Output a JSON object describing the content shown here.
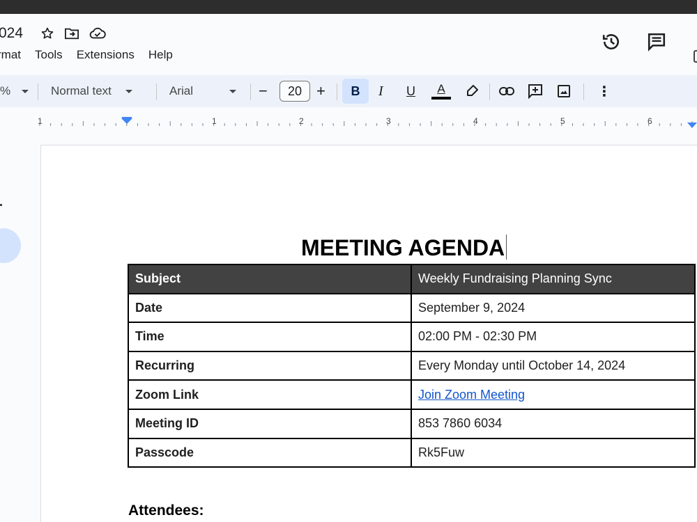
{
  "doc": {
    "title_fragment": "024",
    "menus": [
      "rmat",
      "Tools",
      "Extensions",
      "Help"
    ]
  },
  "toolbar": {
    "zoom_fragment": "%",
    "style": "Normal text",
    "font": "Arial",
    "font_size": "20",
    "bold": "B",
    "italic": "I",
    "underline": "U",
    "text_color": "A",
    "decrease": "−",
    "increase": "+",
    "more": "⋮"
  },
  "ruler": {
    "labels": [
      "1",
      "1",
      "2",
      "3",
      "4",
      "5",
      "6"
    ]
  },
  "document": {
    "heading": "MEETING AGENDA",
    "table": [
      {
        "key": "Subject",
        "value": "Weekly Fundraising Planning Sync"
      },
      {
        "key": "Date",
        "value": "September 9, 2024"
      },
      {
        "key": "Time",
        "value": "02:00 PM - 02:30 PM"
      },
      {
        "key": "Recurring",
        "value": "Every Monday until October 14, 2024"
      },
      {
        "key": "Zoom Link",
        "value": "Join Zoom Meeting"
      },
      {
        "key": "Meeting ID",
        "value": "853 7860 6034"
      },
      {
        "key": "Passcode",
        "value": "Rk5Fuw"
      }
    ],
    "attendees_label": "Attendees:"
  },
  "colors": {
    "accent": "#d3e3fd",
    "header_row": "#424242",
    "link": "#1155cc"
  }
}
